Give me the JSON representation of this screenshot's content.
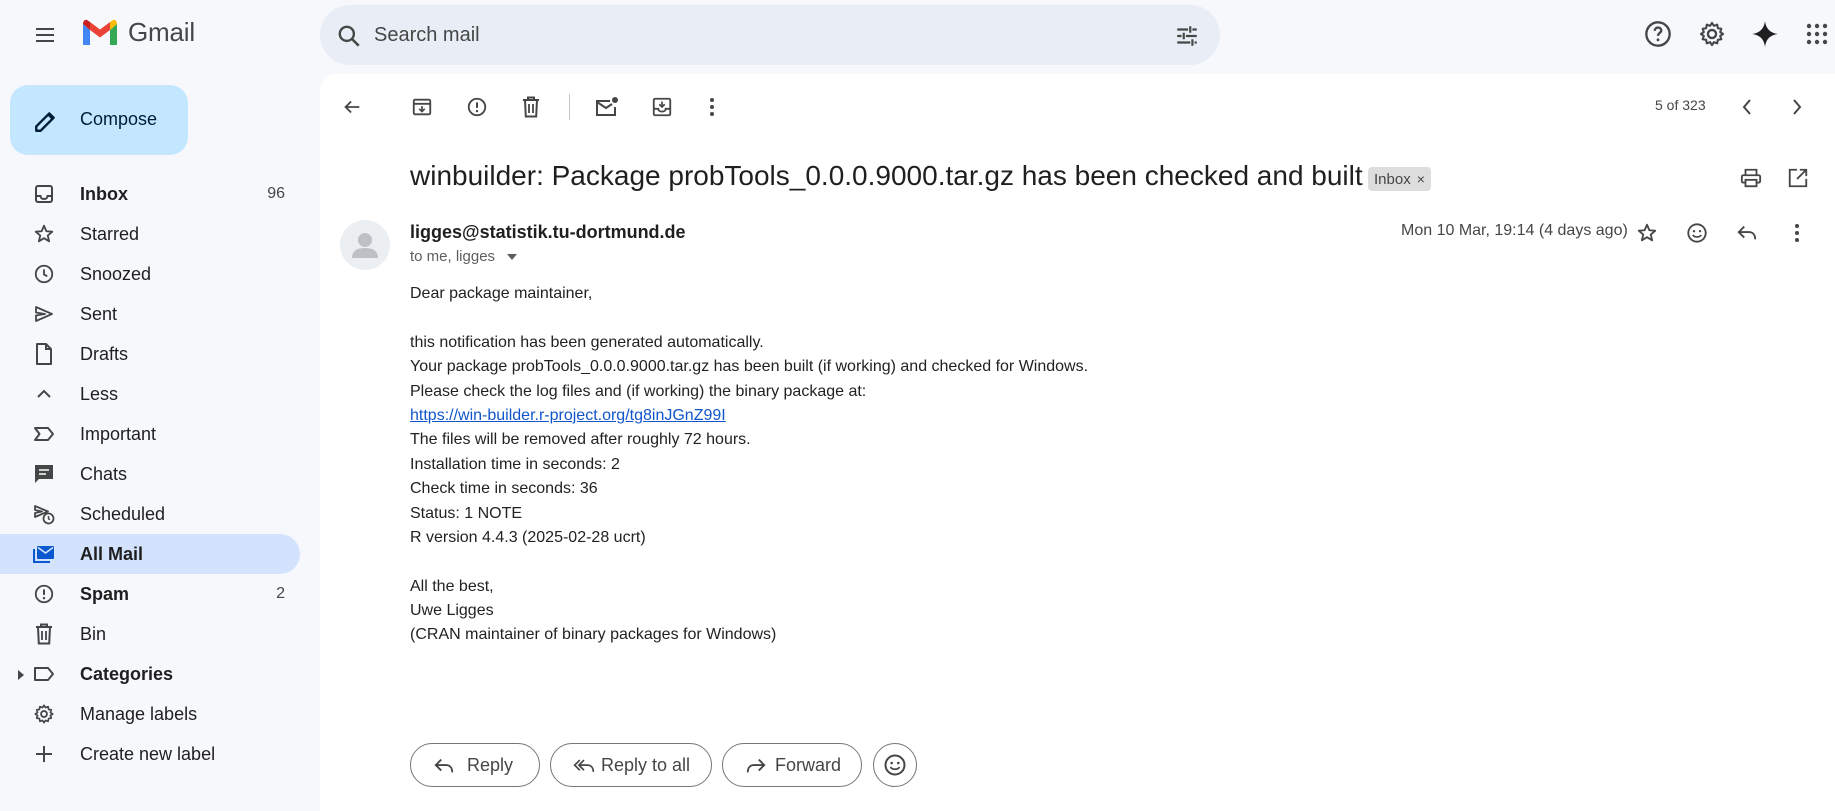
{
  "app": {
    "name": "Gmail"
  },
  "search": {
    "placeholder": "Search mail"
  },
  "compose": {
    "label": "Compose"
  },
  "sidebar": {
    "items": [
      {
        "label": "Inbox",
        "count": "96",
        "bold": true,
        "icon": "inbox-icon"
      },
      {
        "label": "Starred",
        "count": "",
        "icon": "star-icon"
      },
      {
        "label": "Snoozed",
        "count": "",
        "icon": "clock-icon"
      },
      {
        "label": "Sent",
        "count": "",
        "icon": "send-icon"
      },
      {
        "label": "Drafts",
        "count": "",
        "icon": "draft-icon"
      },
      {
        "label": "Less",
        "count": "",
        "icon": "chevron-up-icon"
      },
      {
        "label": "Important",
        "count": "",
        "icon": "important-icon"
      },
      {
        "label": "Chats",
        "count": "",
        "icon": "chat-icon"
      },
      {
        "label": "Scheduled",
        "count": "",
        "icon": "scheduled-icon"
      },
      {
        "label": "All Mail",
        "count": "",
        "bold": true,
        "active": true,
        "icon": "all-mail-icon"
      },
      {
        "label": "Spam",
        "count": "2",
        "bold": true,
        "icon": "spam-icon"
      },
      {
        "label": "Bin",
        "count": "",
        "icon": "trash-icon"
      },
      {
        "label": "Categories",
        "count": "",
        "bold": true,
        "icon": "label-icon"
      },
      {
        "label": "Manage labels",
        "count": "",
        "icon": "gear-icon"
      },
      {
        "label": "Create new label",
        "count": "",
        "icon": "plus-icon"
      }
    ]
  },
  "toolbar": {
    "pager": "5 of 323"
  },
  "message": {
    "subject": "winbuilder: Package probTools_0.0.0.9000.tar.gz has been checked and built",
    "label_badge": "Inbox",
    "sender": "ligges@statistik.tu-dortmund.de",
    "recipients": "to me, ligges",
    "date": "Mon 10 Mar, 19:14 (4 days ago)",
    "body": {
      "greeting": "Dear package maintainer,",
      "line1": "this notification has been generated automatically.",
      "line2": "Your package probTools_0.0.0.9000.tar.gz has been built (if working) and checked for Windows.",
      "line3": "Please check the log files and (if working) the binary package at:",
      "link": "https://win-builder.r-project.org/tg8inJGnZ99I",
      "line4": "The files will be removed after roughly 72 hours.",
      "line5": "Installation time in seconds: 2",
      "line6": "Check time in seconds: 36",
      "line7": "Status: 1 NOTE",
      "line8": "R version 4.4.3 (2025-02-28 ucrt)",
      "closing": "All the best,",
      "signature_name": "Uwe Ligges",
      "signature_role": "(CRAN maintainer of binary packages for Windows)"
    }
  },
  "actions": {
    "reply": "Reply",
    "reply_all": "Reply to all",
    "forward": "Forward"
  },
  "colors": {
    "accent": "#0b57d0",
    "compose_bg": "#c2e7ff",
    "active_nav": "#d3e3fd",
    "link": "#1155cc"
  }
}
